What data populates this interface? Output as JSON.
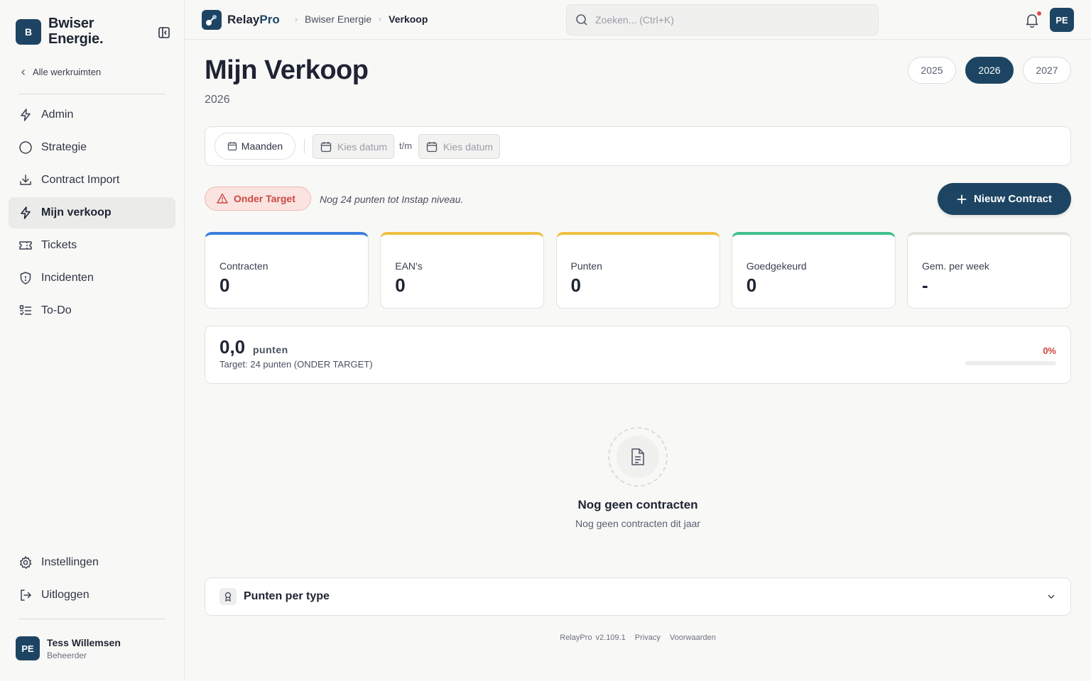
{
  "sidebar": {
    "brand_initial": "B",
    "brand_name": "Bwiser Energie.",
    "back_label": "Alle werkruimten",
    "nav": [
      {
        "label": "Admin",
        "icon": "bolt-icon"
      },
      {
        "label": "Strategie",
        "icon": "circle-icon"
      },
      {
        "label": "Contract Import",
        "icon": "download-icon"
      },
      {
        "label": "Mijn verkoop",
        "icon": "bolt-icon",
        "active": true
      },
      {
        "label": "Tickets",
        "icon": "ticket-icon"
      },
      {
        "label": "Incidenten",
        "icon": "shield-icon"
      },
      {
        "label": "To-Do",
        "icon": "checklist-icon"
      }
    ],
    "bottom_nav": [
      {
        "label": "Instellingen",
        "icon": "gear-icon"
      },
      {
        "label": "Uitloggen",
        "icon": "logout-icon"
      }
    ],
    "user": {
      "initials": "PE",
      "name": "Tess Willemsen",
      "role": "Beheerder"
    }
  },
  "topbar": {
    "logo_part1": "Relay",
    "logo_part2": "Pro",
    "breadcrumb": [
      "Bwiser Energie",
      "Verkoop"
    ],
    "search_placeholder": "Zoeken... (Ctrl+K)",
    "avatar_initials": "PE"
  },
  "page": {
    "title": "Mijn Verkoop",
    "subtitle": "2026",
    "years": [
      "2025",
      "2026",
      "2027"
    ],
    "active_year": "2026"
  },
  "filters": {
    "period_label": "Maanden",
    "date_from_placeholder": "Kies datum",
    "separator": "t/m",
    "date_to_placeholder": "Kies datum"
  },
  "status": {
    "badge": "Onder Target",
    "note": "Nog 24 punten tot Instap niveau.",
    "new_contract": "Nieuw Contract"
  },
  "stats": [
    {
      "label": "Contracten",
      "value": "0",
      "accent": "#3b7ddd"
    },
    {
      "label": "EAN's",
      "value": "0",
      "accent": "#f0c043"
    },
    {
      "label": "Punten",
      "value": "0",
      "accent": "#f0c043"
    },
    {
      "label": "Goedgekeurd",
      "value": "0",
      "accent": "#3fbf8c"
    },
    {
      "label": "Gem. per week",
      "value": "-",
      "accent": "#e2e2df"
    }
  ],
  "progress": {
    "points": "0,0",
    "unit": "punten",
    "target_text": "Target: 24 punten (ONDER TARGET)",
    "percent_label": "0%",
    "fraction": 0
  },
  "empty": {
    "title": "Nog geen contracten",
    "subtitle": "Nog geen contracten dit jaar"
  },
  "accordion": {
    "title": "Punten per type"
  },
  "footer": {
    "app": "RelayPro",
    "version": "v2.109.1",
    "privacy": "Privacy",
    "terms": "Voorwaarden"
  },
  "colors": {
    "brand": "#1d4563",
    "danger": "#d0433d",
    "danger_bg": "#fbe3e0"
  }
}
